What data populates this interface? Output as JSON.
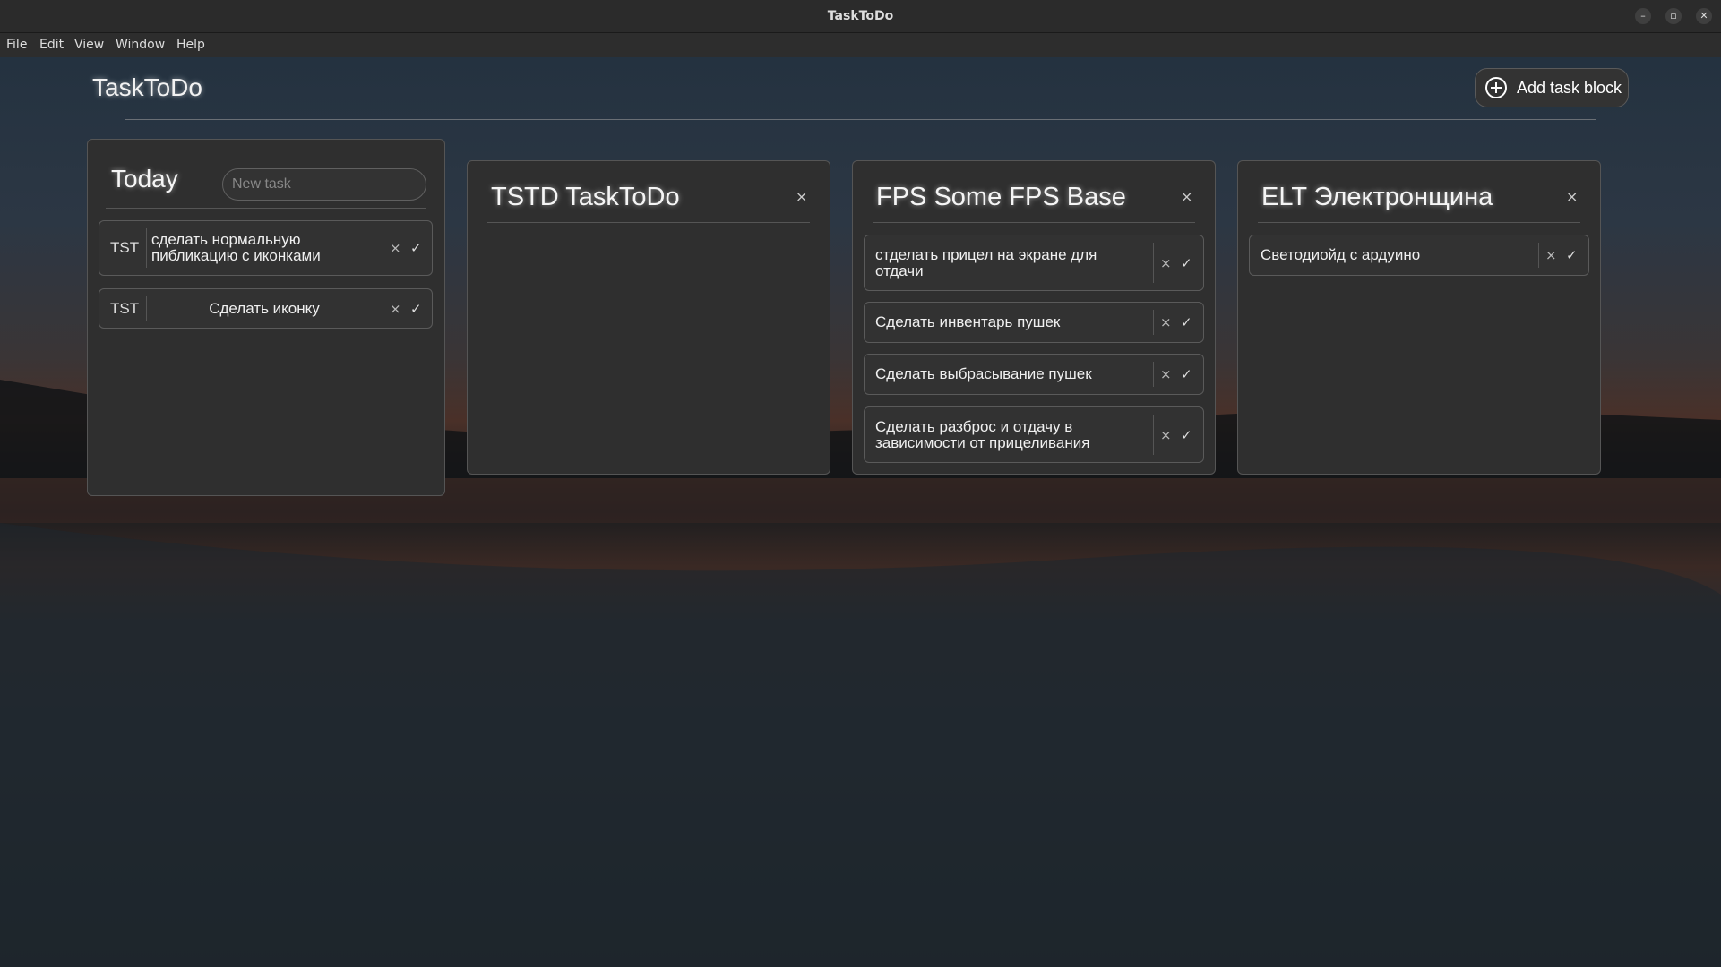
{
  "window": {
    "title": "TaskToDo"
  },
  "menu": [
    "File",
    "Edit",
    "View",
    "Window",
    "Help"
  ],
  "app": {
    "title": "TaskToDo",
    "add_block_label": "Add task block"
  },
  "today": {
    "title": "Today",
    "new_task_placeholder": "New task",
    "tasks": [
      {
        "tag": "TST",
        "line1": "сделать нормальную",
        "line2": "пибликацию с иконками"
      },
      {
        "tag": "TST",
        "line1": "Сделать иконку"
      }
    ]
  },
  "blocks": [
    {
      "title": "TSTD TaskToDo",
      "tasks": []
    },
    {
      "title": "FPS Some FPS Base",
      "tasks": [
        {
          "line1": "стделать прицел на экране для",
          "line2": "отдачи"
        },
        {
          "line1": "Сделать инвентарь пушек"
        },
        {
          "line1": "Сделать выбрасывание пушек"
        },
        {
          "line1": "Сделать разброс и отдачу в",
          "line2": "зависимости от прицеливания"
        }
      ]
    },
    {
      "title": "ELT Электронщина",
      "tasks": [
        {
          "line1": "Светодиойд с ардуино"
        }
      ]
    }
  ],
  "icons": {
    "close": "×",
    "done": "✓",
    "add": "plus-circle-icon",
    "minimize": "–",
    "maximize": "▫",
    "window_close": "✕"
  }
}
